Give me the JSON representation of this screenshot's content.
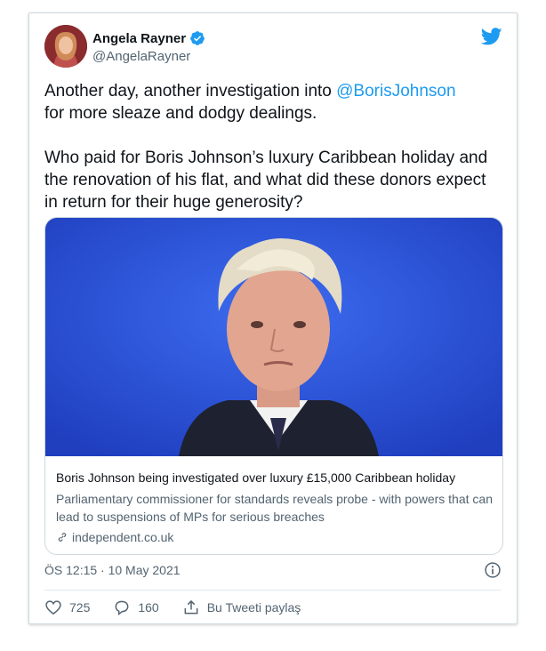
{
  "author": {
    "name": "Angela Rayner",
    "handle": "@AngelaRayner"
  },
  "tweet": {
    "line1_prefix": "Another day, another investigation into ",
    "mention": "@BorisJohnson",
    "line1_suffix": "\nfor more sleaze and dodgy dealings.\n\nWho paid for Boris Johnson’s luxury Caribbean holiday and the renovation of his flat, and what did these donors expect in return for their huge generosity?"
  },
  "link_card": {
    "title": "Boris Johnson being investigated over luxury £15,000 Caribbean holiday",
    "description": "Parliamentary commissioner for standards reveals probe - with powers that can lead to suspensions of MPs for serious breaches",
    "domain": "independent.co.uk"
  },
  "timestamp": "ÖS 12:15 · 10 May 2021",
  "actions": {
    "likes": "725",
    "replies": "160",
    "share_label": "Bu Tweeti paylaş"
  },
  "colors": {
    "accent": "#1d9bf0",
    "photo_background": "#2a4fd6"
  }
}
